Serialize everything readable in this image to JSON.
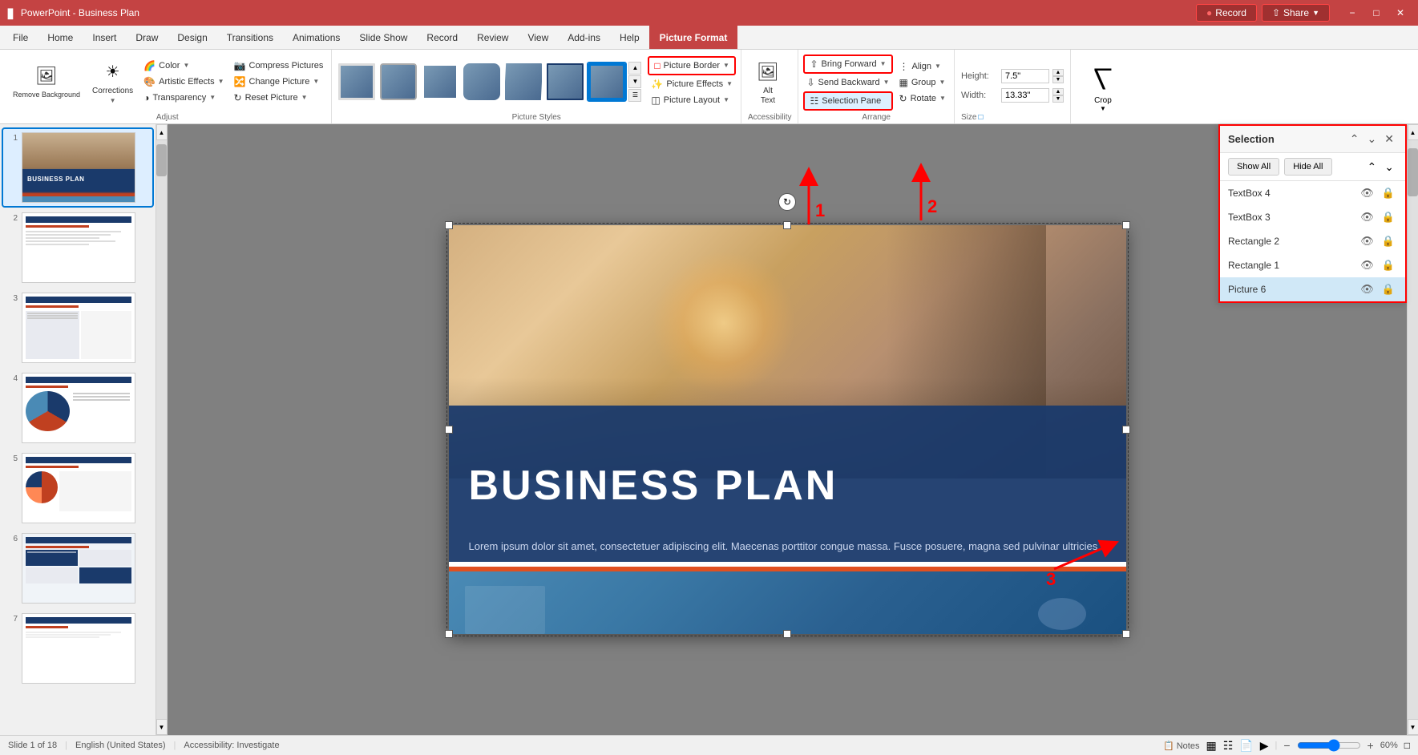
{
  "app": {
    "title": "PowerPoint - Business Plan",
    "window_controls": [
      "minimize",
      "restore",
      "close"
    ]
  },
  "title_bar": {
    "file_label": "File",
    "app_name": "PowerPoint",
    "record_btn": "Record",
    "share_btn": "Share"
  },
  "ribbon_tabs": [
    {
      "id": "file",
      "label": "File"
    },
    {
      "id": "home",
      "label": "Home"
    },
    {
      "id": "insert",
      "label": "Insert"
    },
    {
      "id": "draw",
      "label": "Draw"
    },
    {
      "id": "design",
      "label": "Design"
    },
    {
      "id": "transitions",
      "label": "Transitions"
    },
    {
      "id": "animations",
      "label": "Animations"
    },
    {
      "id": "slide_show",
      "label": "Slide Show"
    },
    {
      "id": "record",
      "label": "Record"
    },
    {
      "id": "review",
      "label": "Review"
    },
    {
      "id": "view",
      "label": "View"
    },
    {
      "id": "add_ins",
      "label": "Add-ins"
    },
    {
      "id": "help",
      "label": "Help"
    },
    {
      "id": "picture_format",
      "label": "Picture Format",
      "active": true
    }
  ],
  "ribbon": {
    "adjust_group_label": "Adjust",
    "remove_bg_label": "Remove\nBackground",
    "corrections_label": "Corrections",
    "color_label": "Color",
    "artistic_effects_label": "Artistic Effects",
    "transparency_label": "Transparency",
    "compress_pictures_label": "Compress Pictures",
    "change_picture_label": "Change Picture",
    "reset_picture_label": "Reset Picture",
    "picture_styles_label": "Picture Styles",
    "picture_border_label": "Picture Border",
    "picture_effects_label": "Picture Effects",
    "picture_layout_label": "Picture Layout",
    "accessibility_label": "Accessibility",
    "alt_text_label": "Alt\nText",
    "arrange_label": "Arrange",
    "bring_forward_label": "Bring Forward",
    "send_backward_label": "Send Backward",
    "selection_pane_label": "Selection Pane",
    "align_label": "Align",
    "group_label": "Group",
    "rotate_label": "Rotate",
    "size_label": "Size",
    "height_label": "Height:",
    "height_value": "7.5\"",
    "width_label": "Width:",
    "width_value": "13.33\"",
    "crop_label": "Crop"
  },
  "selection_pane": {
    "title": "Selection",
    "show_all_btn": "Show All",
    "hide_all_btn": "Hide All",
    "items": [
      {
        "name": "TextBox 4",
        "visible": true,
        "locked": false
      },
      {
        "name": "TextBox 3",
        "visible": true,
        "locked": false
      },
      {
        "name": "Rectangle 2",
        "visible": true,
        "locked": false
      },
      {
        "name": "Rectangle 1",
        "visible": true,
        "locked": false
      },
      {
        "name": "Picture 6",
        "visible": true,
        "locked": false,
        "selected": true
      }
    ]
  },
  "slide": {
    "title": "BUSINESS PLAN",
    "subtitle": "Lorem ipsum dolor sit amet, consectetuer adipiscing elit. Maecenas porttitor\ncongue massa. Fusce posuere, magna sed pulvinar ultricies."
  },
  "slide_panel": {
    "slides": [
      1,
      2,
      3,
      4,
      5,
      6,
      7
    ],
    "total": 18,
    "current": 1
  },
  "status_bar": {
    "slide_info": "Slide 1 of 18",
    "language": "English (United States)",
    "accessibility": "Accessibility: Investigate",
    "notes": "Notes",
    "zoom": "Zoom"
  },
  "annotations": {
    "label_1": "1",
    "label_2": "2",
    "label_3": "3"
  }
}
